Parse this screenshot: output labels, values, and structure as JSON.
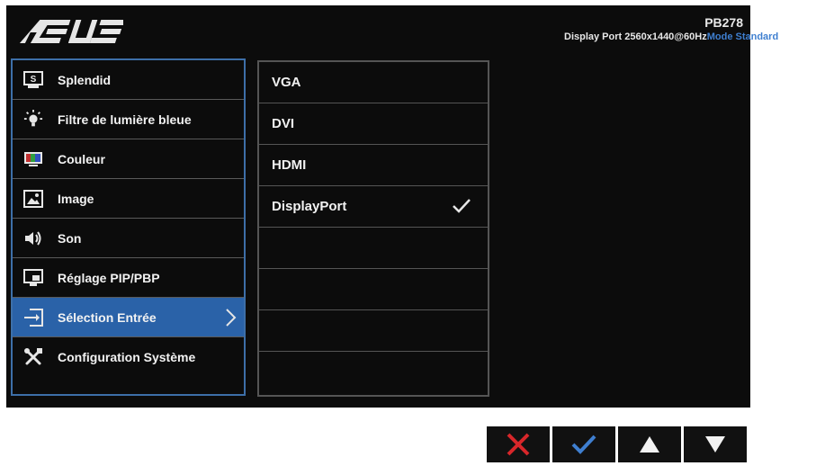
{
  "header": {
    "logo_text": "ASUS",
    "model": "PB278",
    "input_info": "Display Port  2560x1440@60Hz",
    "mode_info": "Mode Standard"
  },
  "menu": {
    "items": [
      {
        "label": "Splendid",
        "icon": "splendid-icon"
      },
      {
        "label": "Filtre de lumière bleue",
        "icon": "blue-light-icon"
      },
      {
        "label": "Couleur",
        "icon": "color-icon"
      },
      {
        "label": "Image",
        "icon": "image-icon"
      },
      {
        "label": "Son",
        "icon": "speaker-icon"
      },
      {
        "label": "Réglage PIP/PBP",
        "icon": "pip-icon"
      },
      {
        "label": "Sélection Entrée",
        "icon": "input-select-icon",
        "selected": true
      },
      {
        "label": "Configuration Système",
        "icon": "tools-icon"
      }
    ]
  },
  "submenu": {
    "items": [
      {
        "label": "VGA"
      },
      {
        "label": "DVI"
      },
      {
        "label": "HDMI"
      },
      {
        "label": "DisplayPort",
        "checked": true
      },
      {
        "label": ""
      },
      {
        "label": ""
      },
      {
        "label": ""
      },
      {
        "label": ""
      }
    ]
  },
  "buttons": [
    {
      "name": "close",
      "icon": "close-x-icon"
    },
    {
      "name": "confirm",
      "icon": "checkmark-icon"
    },
    {
      "name": "up",
      "icon": "triangle-up-icon"
    },
    {
      "name": "down",
      "icon": "triangle-down-icon"
    }
  ],
  "colors": {
    "osd_bg": "#0c0c0c",
    "accent": "#2a62a8",
    "close_red": "#d8262a",
    "check_blue": "#3f7fd0"
  }
}
